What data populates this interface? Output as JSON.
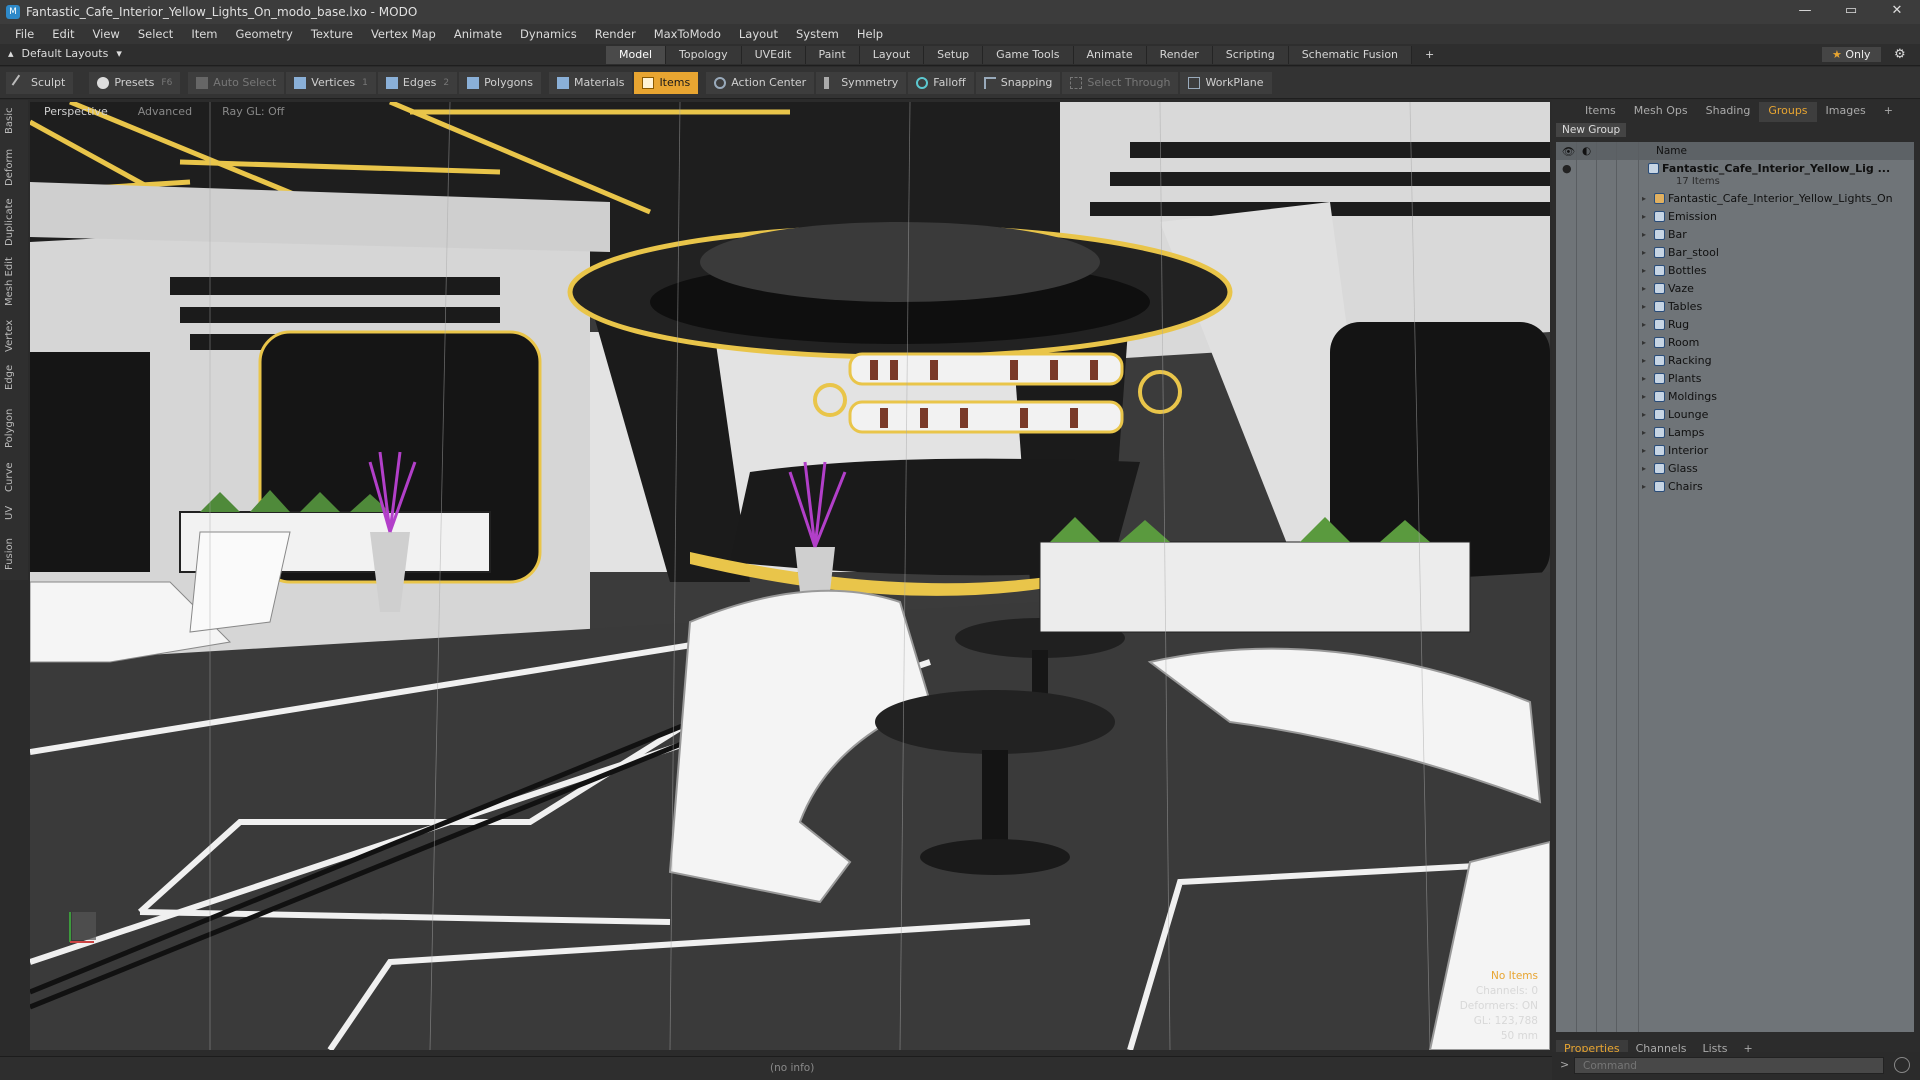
{
  "window": {
    "title": "Fantastic_Cafe_Interior_Yellow_Lights_On_modo_base.lxo - MODO",
    "app_icon": "modo-icon",
    "controls": [
      "—",
      "▭",
      "✕"
    ]
  },
  "menu": [
    "File",
    "Edit",
    "View",
    "Select",
    "Item",
    "Geometry",
    "Texture",
    "Vertex Map",
    "Animate",
    "Dynamics",
    "Render",
    "MaxToModo",
    "Layout",
    "System",
    "Help"
  ],
  "layout_tabs": {
    "layouts_label": "Default Layouts",
    "tabs": [
      "Model",
      "Topology",
      "UVEdit",
      "Paint",
      "Layout",
      "Setup",
      "Game Tools",
      "Animate",
      "Render",
      "Scripting",
      "Schematic Fusion",
      "+"
    ],
    "active": "Model",
    "only_label": "Only"
  },
  "toolbar": {
    "sculpt": "Sculpt",
    "presets": "Presets",
    "presets_key": "F6",
    "auto_select": "Auto Select",
    "vertices": "Vertices",
    "vertices_key": "1",
    "edges": "Edges",
    "edges_key": "2",
    "polygons": "Polygons",
    "materials": "Materials",
    "items": "Items",
    "action_center": "Action Center",
    "symmetry": "Symmetry",
    "falloff": "Falloff",
    "snapping": "Snapping",
    "select_through": "Select Through",
    "workplane": "WorkPlane"
  },
  "left_tabs": [
    "Basic",
    "Deform",
    "Duplicate",
    "Mesh Edit",
    "Vertex",
    "Edge",
    "Polygon",
    "Curve",
    "UV",
    "Fusion"
  ],
  "viewport": {
    "view": "Perspective",
    "shading": "Advanced",
    "raygl": "Ray GL: Off",
    "stats": {
      "no_items": "No Items",
      "channels": "Channels: 0",
      "deformers": "Deformers: ON",
      "gl": "GL: 123,788",
      "lens": "50 mm"
    }
  },
  "status_info": "(no info)",
  "right_panel": {
    "tabs": [
      "Items",
      "Mesh Ops",
      "Shading",
      "Groups",
      "Images",
      "+"
    ],
    "active": "Groups",
    "new_group": "New Group",
    "column_name": "Name",
    "root": {
      "name": "Fantastic_Cafe_Interior_Yellow_Lig ...",
      "count": "17 Items"
    },
    "children": [
      "Fantastic_Cafe_Interior_Yellow_Lights_On",
      "Emission",
      "Bar",
      "Bar_stool",
      "Bottles",
      "Vaze",
      "Tables",
      "Rug",
      "Room",
      "Racking",
      "Plants",
      "Moldings",
      "Lounge",
      "Lamps",
      "Interior",
      "Glass",
      "Chairs"
    ],
    "properties_tabs": [
      "Properties",
      "Channels",
      "Lists",
      "+"
    ],
    "properties_active": "Properties"
  },
  "command": {
    "placeholder": "Command",
    "prompt": ">"
  },
  "colors": {
    "accent": "#e8a531",
    "tree_bg": "#6f7478"
  }
}
